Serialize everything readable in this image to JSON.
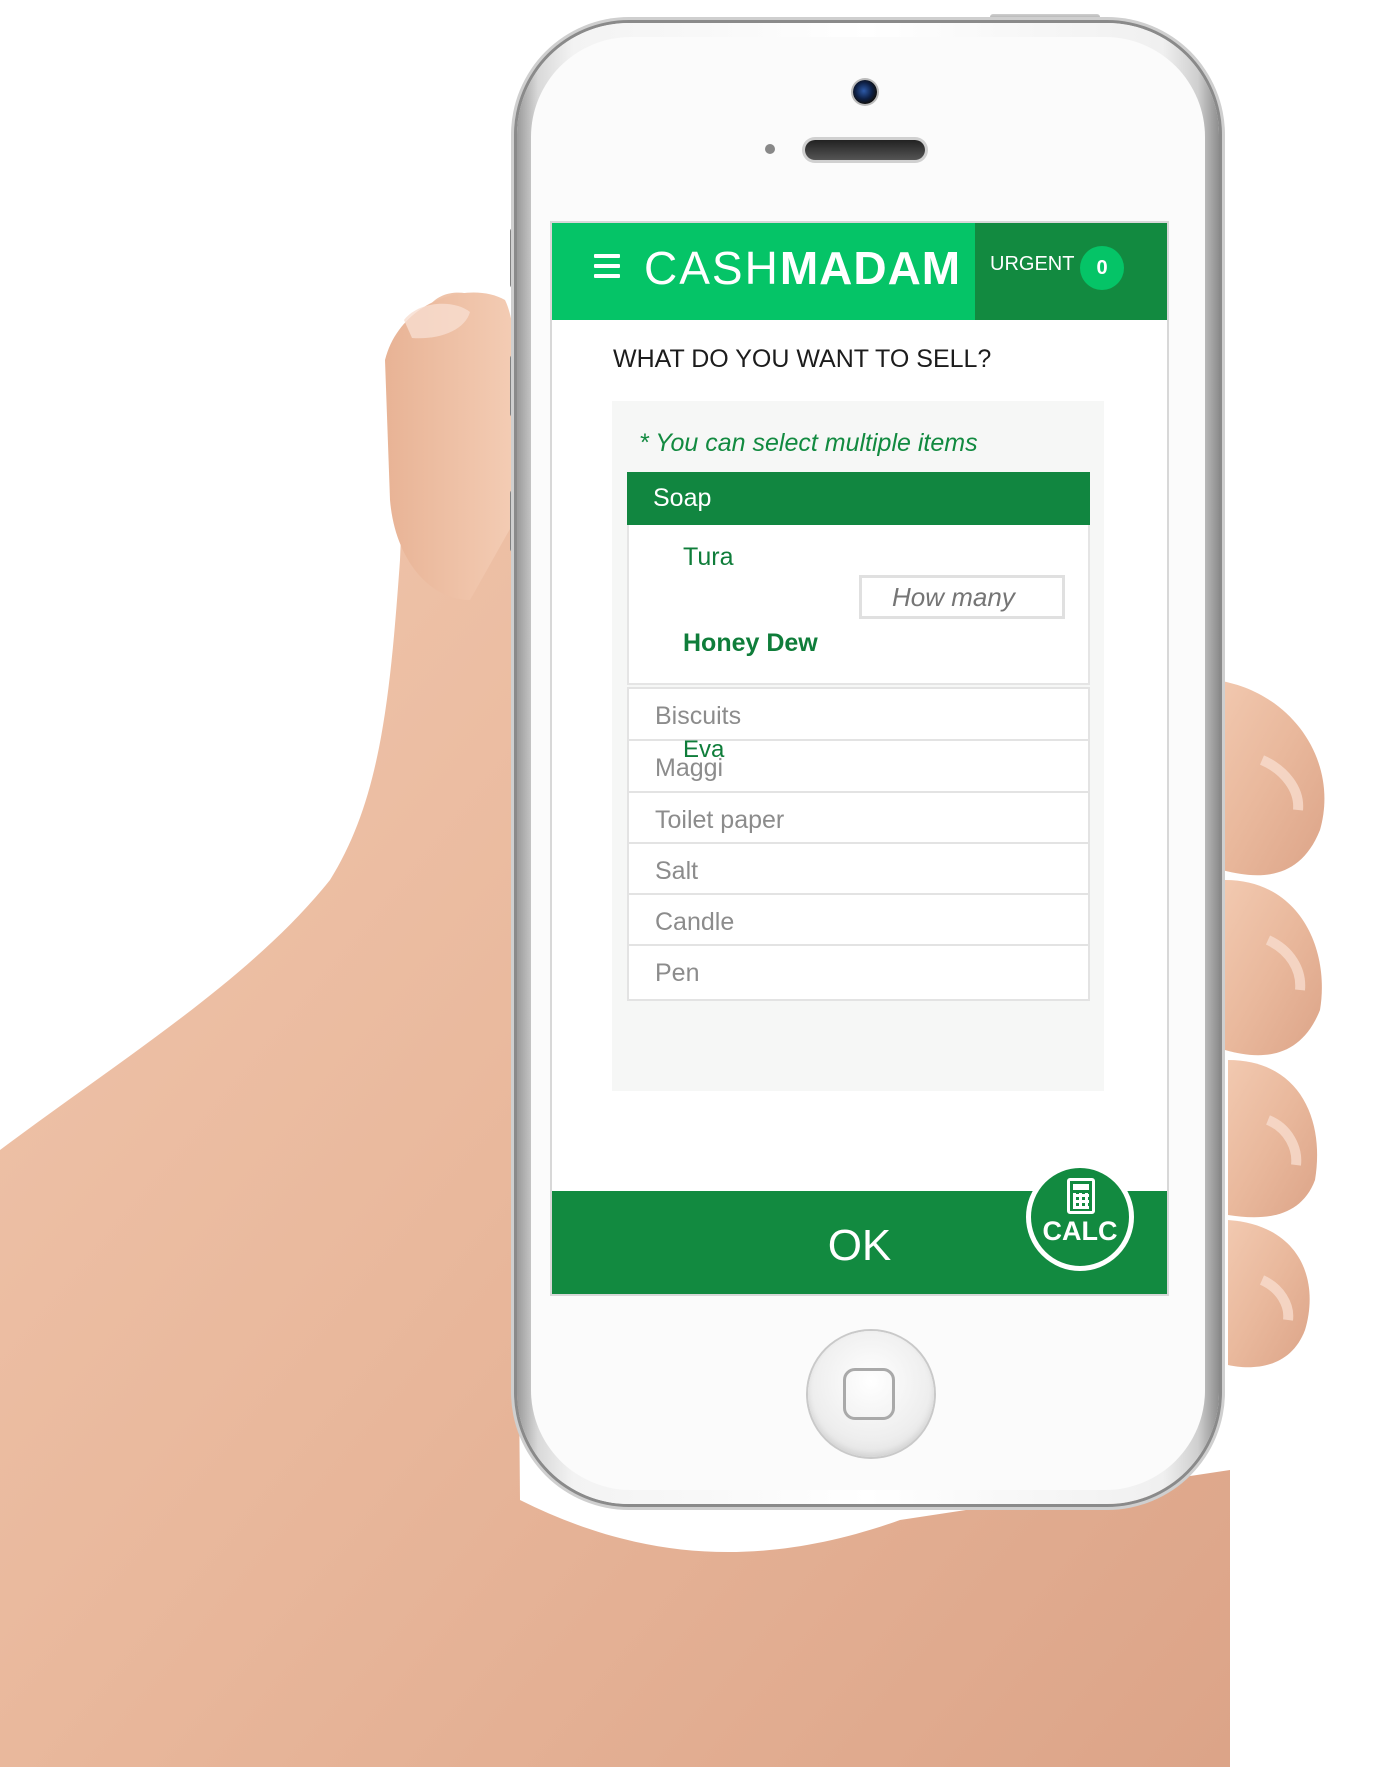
{
  "app": {
    "brand_light": "CASH",
    "brand_bold": "MADAM",
    "urgent_label": "URGENT",
    "urgent_count": "0"
  },
  "main": {
    "question": "WHAT DO YOU WANT TO SELL?",
    "hint": "* You can select multiple items",
    "open_category": "Soap",
    "sub_items": [
      "Tura",
      "Honey Dew"
    ],
    "selected_sub_item": "Honey Dew",
    "quantity_placeholder": "How many",
    "categories": [
      "Biscuits",
      "Maggi",
      "Toilet paper",
      "Salt",
      "Candle",
      "Pen"
    ],
    "floating_item": "Eva"
  },
  "footer": {
    "ok_label": "OK",
    "calc_label": "CALC"
  },
  "colors": {
    "header_green": "#05c467",
    "dark_green": "#128a40",
    "text_green": "#0f7d3a"
  },
  "icons": [
    "hamburger-menu-icon",
    "calculator-icon"
  ]
}
